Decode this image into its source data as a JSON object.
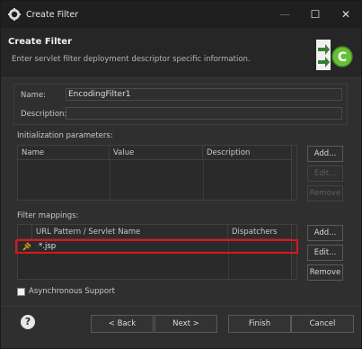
{
  "window": {
    "title": "Create Filter",
    "controls": {
      "minimize": "—",
      "maximize": "☐",
      "close": "✕"
    }
  },
  "banner": {
    "title": "Create Filter",
    "description": "Enter servlet filter deployment descriptor specific information.",
    "graphic_icon": "filter-wizard-icon"
  },
  "form": {
    "name_label": "Name:",
    "name_value": "EncodingFilter1",
    "description_label": "Description:",
    "description_value": ""
  },
  "init_params": {
    "label": "Initialization parameters:",
    "columns": [
      "Name",
      "Value",
      "Description"
    ],
    "rows": [],
    "buttons": {
      "add": "Add...",
      "edit": "Edit...",
      "remove": "Remove"
    }
  },
  "mappings": {
    "label": "Filter mappings:",
    "columns": [
      "URL Pattern / Servlet Name",
      "Dispatchers"
    ],
    "rows": [
      {
        "pattern": "*.jsp",
        "dispatchers": "",
        "icon": "url-pattern-icon"
      }
    ],
    "buttons": {
      "add": "Add...",
      "edit": "Edit...",
      "remove": "Remove"
    }
  },
  "async": {
    "label": "Asynchronous Support",
    "checked": false
  },
  "footer": {
    "help": "?",
    "back": "< Back",
    "next": "Next >",
    "finish": "Finish",
    "cancel": "Cancel"
  }
}
